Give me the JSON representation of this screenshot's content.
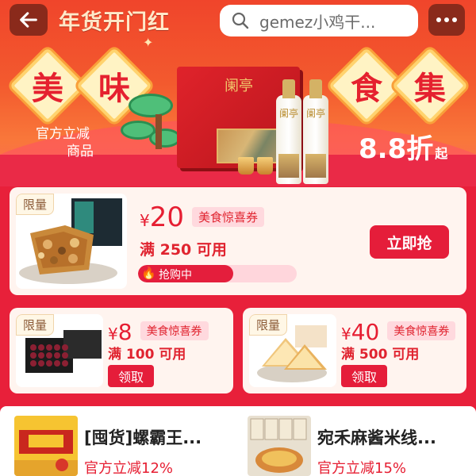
{
  "header": {
    "title": "年货开门红",
    "search_text": "gemez小鸡干...",
    "back_icon": "arrow-left-icon",
    "more_icon": "more-dots-icon",
    "search_icon": "search-icon"
  },
  "banner": {
    "chars": [
      "美",
      "味",
      "食",
      "集"
    ],
    "left_promo_line1": "官方立减",
    "left_promo_line2": "商品",
    "discount_value": "8.8折",
    "discount_suffix": "起",
    "product_label": "阑亭",
    "bottle_label": "阑亭"
  },
  "featured_coupon": {
    "tag": "限量",
    "currency": "¥",
    "amount": "20",
    "badge": "美食惊喜券",
    "condition": "满 250 可用",
    "progress_text": "抢购中",
    "progress_fraction": 0.6,
    "button": "立即抢"
  },
  "coupons": [
    {
      "tag": "限量",
      "currency": "¥",
      "amount": "8",
      "badge": "美食惊喜券",
      "condition": "满 100 可用",
      "button": "领取"
    },
    {
      "tag": "限量",
      "currency": "¥",
      "amount": "40",
      "badge": "美食惊喜券",
      "condition": "满 500 可用",
      "button": "领取"
    }
  ],
  "products": [
    {
      "name": "[囤货]螺霸王...",
      "discount": "官方立减12%"
    },
    {
      "name": "宛禾麻酱米线...",
      "discount": "官方立减15%"
    }
  ],
  "colors": {
    "accent": "#e51d3a",
    "banner": "#f0452b"
  }
}
